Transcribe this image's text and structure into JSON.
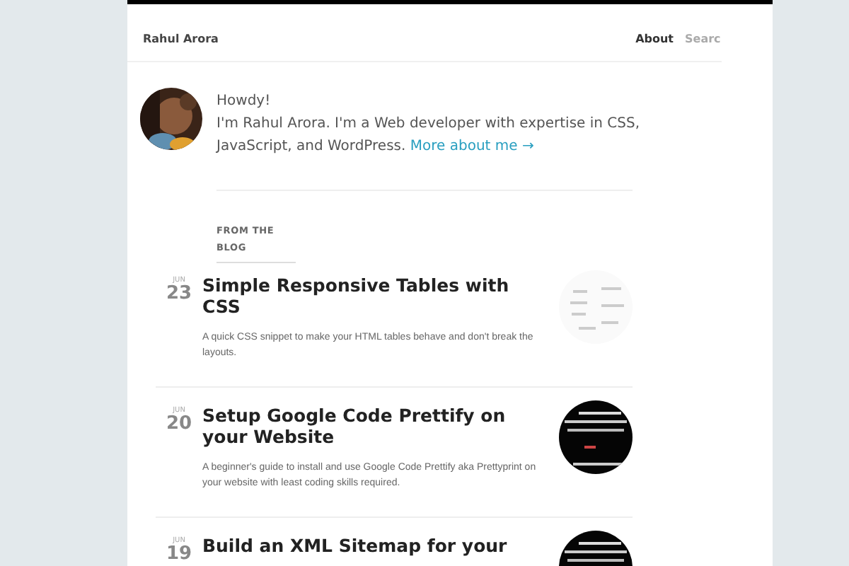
{
  "header": {
    "site_title": "Rahul Arora",
    "nav": [
      {
        "label": "About",
        "selected": true
      }
    ],
    "search": {
      "placeholder": "Searc"
    }
  },
  "intro": {
    "greeting": "Howdy!",
    "bio": "I'm Rahul Arora. I'm a Web developer with expertise in CSS, JavaScript, and WordPress.",
    "link": "More about me →"
  },
  "section_label": "FROM THE BLOG",
  "posts": [
    {
      "month": "JUN",
      "day": "23",
      "title": "Simple Responsive Tables with CSS",
      "excerpt": "A quick CSS snippet to make your HTML tables behave and don't break the layouts."
    },
    {
      "month": "JUN",
      "day": "20",
      "title": "Setup Google Code Prettify on your Website",
      "excerpt": "A beginner's guide to install and use Google Code Prettify aka Prettyprint on your website with least coding skills required."
    },
    {
      "month": "JUN",
      "day": "19",
      "title": "Build an XML Sitemap for your"
    }
  ]
}
